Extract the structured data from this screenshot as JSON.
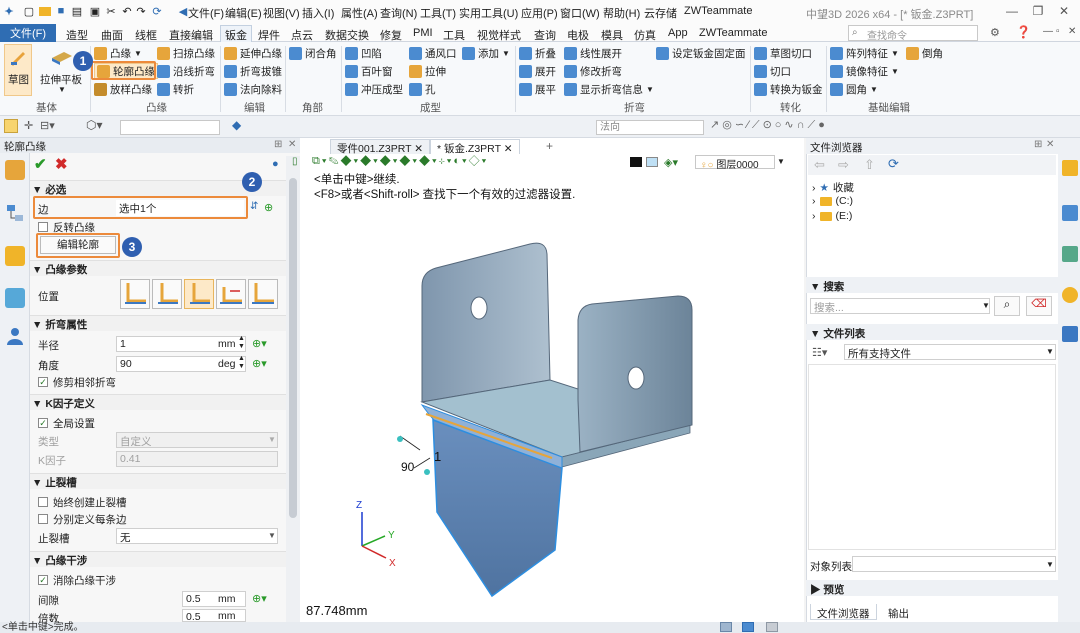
{
  "app": {
    "window_title": "中望3D 2026 x64 - [* 钣金.Z3PRT]"
  },
  "menu": [
    "文件(F)",
    "编辑(E)",
    "视图(V)",
    "插入(I)",
    "属性(A)",
    "查询(N)",
    "工具(T)",
    "实用工具(U)",
    "应用(P)",
    "窗口(W)",
    "帮助(H)",
    "云存储",
    "ZWTeammate"
  ],
  "ribbon_tabs": {
    "file": "文件(F)",
    "tabs": [
      "造型",
      "曲面",
      "线框",
      "直接编辑",
      "钣金",
      "焊件",
      "点云",
      "数据交换",
      "修复",
      "PMI",
      "工具",
      "视觉样式",
      "查询",
      "电极",
      "模具",
      "仿真",
      "App",
      "ZWTeammate"
    ],
    "active": "钣金"
  },
  "search": {
    "placeholder": "查找命令"
  },
  "ribbon": {
    "base": {
      "sketch": "草图",
      "extrude": "拉伸平板",
      "group": "基体"
    },
    "flange": {
      "items": [
        "凸缘",
        "轮廓凸缘",
        "放样凸缘",
        "扫掠凸缘",
        "沿线折弯",
        "转折"
      ],
      "group": "凸缘"
    },
    "edit": {
      "items": [
        "延伸凸缘",
        "折弯拔锥",
        "法向除料"
      ],
      "group": "编辑"
    },
    "corner": {
      "items": [
        "闭合角"
      ],
      "group": "角部"
    },
    "form": {
      "items": [
        "凹陷",
        "百叶窗",
        "冲压成型",
        "通风口",
        "拉伸",
        "孔",
        "添加"
      ],
      "group": "成型"
    },
    "bend": {
      "items": [
        "折叠",
        "展开",
        "展平",
        "线性展开",
        "修改折弯",
        "显示折弯信息",
        "设定钣金固定面"
      ],
      "group": "折弯"
    },
    "convert": {
      "items": [
        "草图切口",
        "切口",
        "转换为钣金"
      ],
      "group": "转化"
    },
    "basic_edit": {
      "items": [
        "阵列特征",
        "镜像特征",
        "圆角",
        "倒角"
      ],
      "group": "基础编辑"
    }
  },
  "toolbar2": {
    "filter_value": "法向"
  },
  "panel": {
    "title": "轮廓凸缘",
    "required_section": "必选",
    "edge_label": "边",
    "edge_value": "选中1个",
    "reverse_label": "反转凸缘",
    "edit_profile": "编辑轮廓",
    "params_section": "凸缘参数",
    "position_label": "位置",
    "bend_section": "折弯属性",
    "radius_label": "半径",
    "radius_value": "1",
    "radius_unit": "mm",
    "angle_label": "角度",
    "angle_value": "90",
    "angle_unit": "deg",
    "trim_label": "修剪相邻折弯",
    "k_section": "K因子定义",
    "global_label": "全局设置",
    "type_label": "类型",
    "type_value": "自定义",
    "k_label": "K因子",
    "k_value": "0.41",
    "relief_section": "止裂槽",
    "always_relief": "始终创建止裂槽",
    "per_edge": "分别定义每条边",
    "relief_label": "止裂槽",
    "relief_value": "无",
    "interf_section": "凸缘干涉",
    "remove_interf": "消除凸缘干涉",
    "gap_label": "间隙",
    "gap_value": "0.5",
    "gap_unit": "mm",
    "times_label": "倍数",
    "times_value": "0.5",
    "times_unit": "mm"
  },
  "callouts": [
    "1",
    "2",
    "3"
  ],
  "viewport": {
    "tabs": [
      "零件001.Z3PRT",
      "* 钣金.Z3PRT"
    ],
    "hint1": "<单击中键>继续.",
    "hint2": "<F8>或者<Shift-roll> 查找下一个有效的过滤器设置.",
    "layer": "图层0000",
    "angle_dim": "90",
    "radius_dim": "1",
    "measure": "87.748mm",
    "axis_x": "X",
    "axis_y": "Y",
    "axis_z": "Z"
  },
  "browser": {
    "title": "文件浏览器",
    "tree": [
      "收藏",
      "(C:)",
      "(E:)"
    ],
    "search_section": "搜索",
    "search_placeholder": "搜索...",
    "filelist_section": "文件列表",
    "filter": "所有支持文件",
    "object_list": "对象列表",
    "preview": "预览",
    "bottom_tabs": [
      "文件浏览器",
      "输出"
    ]
  },
  "status": {
    "text": "<单击中键>完成。"
  },
  "colors": {
    "accent": "#2f6db3",
    "highlight": "#ec8a3b",
    "callout": "#2f5fb0",
    "part": "#a9c4d4",
    "part_dark": "#5f7f9a",
    "flange": "#5b80ad"
  }
}
